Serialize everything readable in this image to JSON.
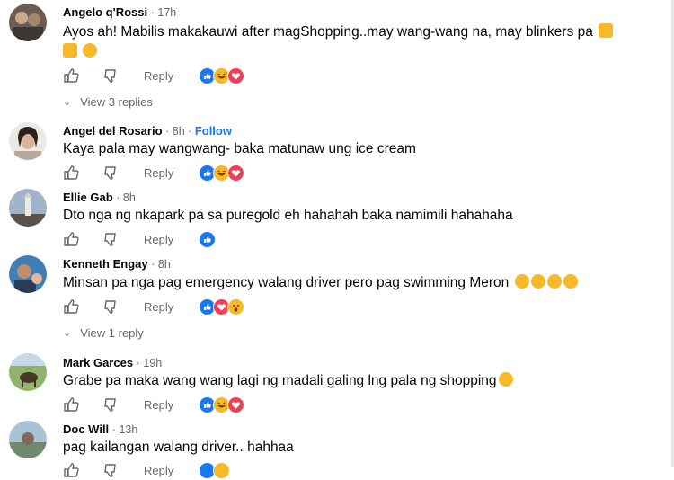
{
  "comments": [
    {
      "name": "Angelo q'Rossi",
      "time": "17h",
      "follow": "",
      "text": "Ayos ah! Mabilis makakauwi after magShopping..may wang-wang na, may blinkers pa",
      "reply_label": "Reply",
      "reactions": [
        "like-icon",
        "haha-icon",
        "love-icon"
      ],
      "view_replies": "View 3 replies"
    },
    {
      "name": "Angel del Rosario",
      "time": "8h",
      "follow": "Follow",
      "text": "Kaya pala may wangwang- baka matunaw ung ice cream",
      "reply_label": "Reply",
      "reactions": [
        "like-icon",
        "haha-icon",
        "love-icon"
      ]
    },
    {
      "name": "Ellie Gab",
      "time": "8h",
      "follow": "",
      "text": "Dto nga ng nkapark pa sa puregold eh hahahah baka namimili hahahaha",
      "reply_label": "Reply",
      "reactions": [
        "like-icon"
      ]
    },
    {
      "name": "Kenneth Engay",
      "time": "8h",
      "follow": "",
      "text": "Minsan pa nga pag emergency walang driver pero pag swimming Meron",
      "reply_label": "Reply",
      "reactions": [
        "like-icon",
        "love-icon",
        "wow-icon"
      ],
      "view_replies": "View 1 reply"
    },
    {
      "name": "Mark Garces",
      "time": "19h",
      "follow": "",
      "text": "Grabe pa maka wang wang lagi ng madali galing lng pala ng shopping",
      "reply_label": "Reply",
      "reactions": [
        "like-icon",
        "haha-icon",
        "love-icon"
      ]
    },
    {
      "name": "Doc Will",
      "time": "13h",
      "follow": "",
      "text": "pag kailangan walang driver.. hahhaa",
      "reply_label": "Reply",
      "reactions": [
        "like-icon",
        "haha-icon"
      ]
    }
  ],
  "colors": {
    "accent": "#1877f2",
    "muted": "#65676b",
    "love": "#f33e58",
    "haha": "#f7b928"
  }
}
